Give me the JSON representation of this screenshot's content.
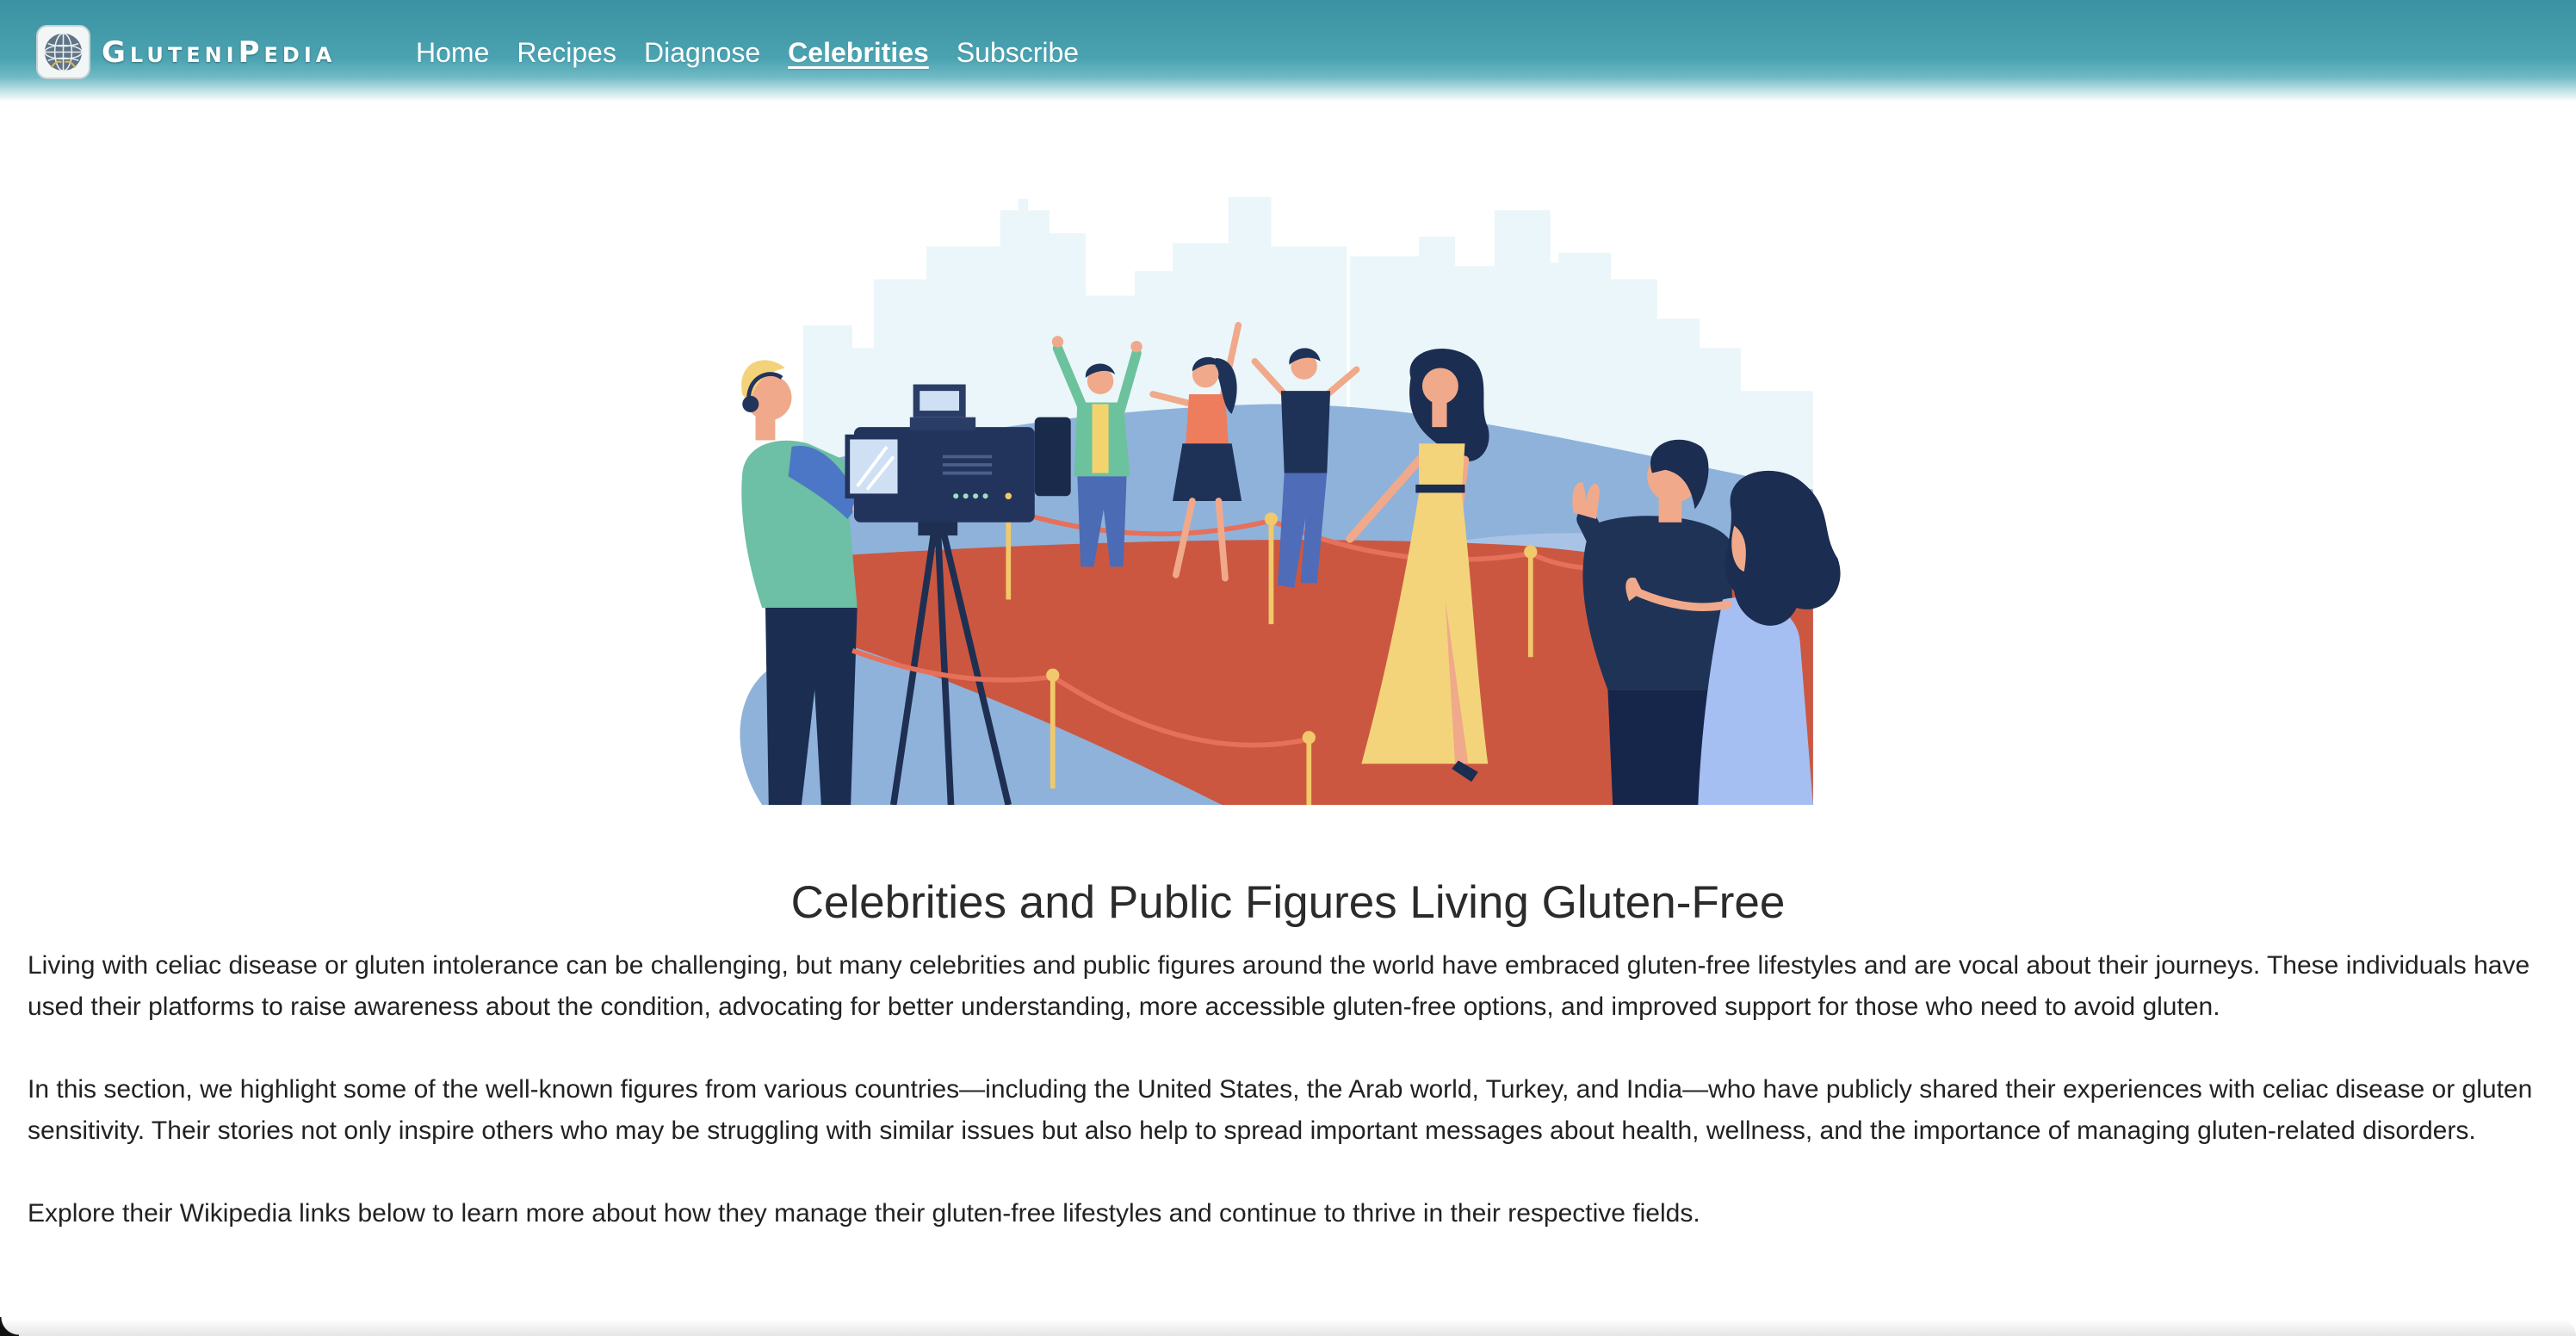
{
  "header": {
    "brand": "GluteniPedia",
    "nav": [
      {
        "label": "Home",
        "active": false
      },
      {
        "label": "Recipes",
        "active": false
      },
      {
        "label": "Diagnose",
        "active": false
      },
      {
        "label": "Celebrities",
        "active": true
      },
      {
        "label": "Subscribe",
        "active": false
      }
    ]
  },
  "main": {
    "title": "Celebrities and Public Figures Living Gluten-Free",
    "paragraphs": [
      "Living with celiac disease or gluten intolerance can be challenging, but many celebrities and public figures around the world have embraced gluten-free lifestyles and are vocal about their journeys. These individuals have used their platforms to raise awareness about the condition, advocating for better understanding, more accessible gluten-free options, and improved support for those who need to avoid gluten.",
      "In this section, we highlight some of the well-known figures from various countries—including the United States, the Arab world, Turkey, and India—who have publicly shared their experiences with celiac disease or gluten sensitivity. Their stories not only inspire others who may be struggling with similar issues but also help to spread important messages about health, wellness, and the importance of managing gluten-related disorders.",
      "Explore their Wikipedia links below to learn more about how they manage their gluten-free lifestyles and continue to thrive in their respective fields."
    ]
  },
  "icons": {
    "logo": "globe-logo-icon",
    "hero": "red-carpet-illustration"
  },
  "colors": {
    "nav_top": "#3a92a2",
    "nav_mid": "#4ba3b1",
    "text": "#222222",
    "heading": "#2b2b2b"
  }
}
